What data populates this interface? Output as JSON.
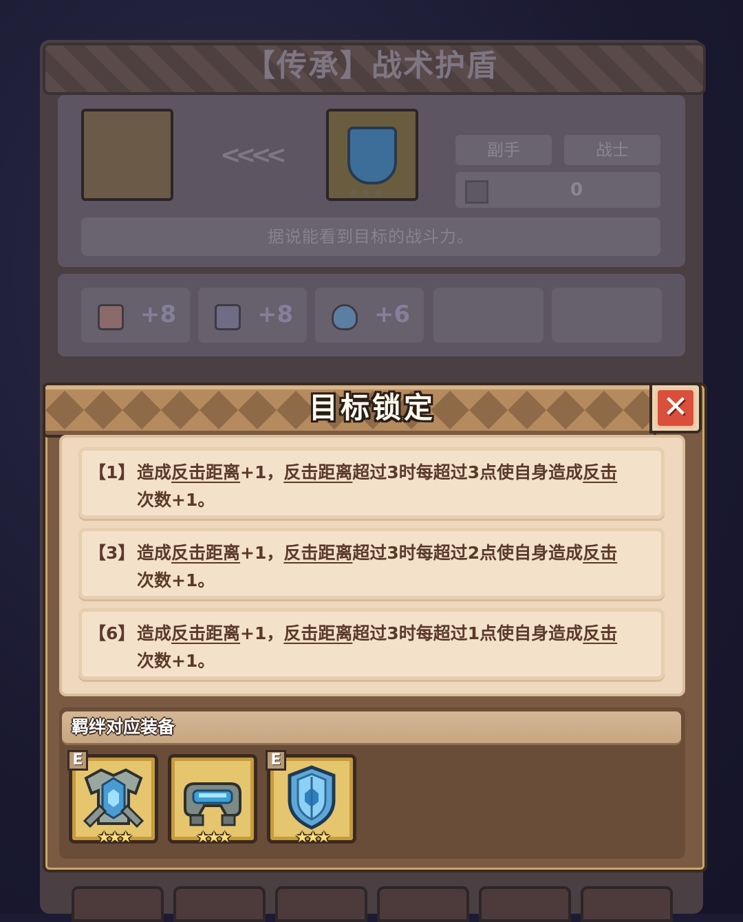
{
  "background": {
    "title": "【传承】战术护盾",
    "arrows": "<<<<",
    "tags": [
      "副手",
      "战士"
    ],
    "power_value": "0",
    "description": "据说能看到目标的战斗力。",
    "stats": [
      {
        "icon": "card-icon",
        "value": "+8"
      },
      {
        "icon": "book-icon",
        "value": "+8"
      },
      {
        "icon": "drop-icon",
        "value": "+6"
      }
    ],
    "item_stars": "★★★"
  },
  "popup": {
    "title": "目标锁定",
    "close_label": "✕",
    "effects": [
      {
        "index": "【1】",
        "pre": "造成",
        "term1": "反击距离",
        "mid1": "+1，",
        "term2": "反击距离",
        "mid2": "超过3时每超过3点使自身造成",
        "term3": "反击",
        "term4": "次数",
        "end": "+1。"
      },
      {
        "index": "【3】",
        "pre": "造成",
        "term1": "反击距离",
        "mid1": "+1，",
        "term2": "反击距离",
        "mid2": "超过3时每超过2点使自身造成",
        "term3": "反击",
        "term4": "次数",
        "end": "+1。"
      },
      {
        "index": "【6】",
        "pre": "造成",
        "term1": "反击距离",
        "mid1": "+1，",
        "term2": "反击距离",
        "mid2": "超过3时每超过1点使自身造成",
        "term3": "反击",
        "term4": "次数",
        "end": "+1。"
      }
    ],
    "bond": {
      "title": "羁绊对应装备",
      "items": [
        {
          "icon": "armor-icon",
          "badge": "E",
          "stars": "★★★"
        },
        {
          "icon": "goggles-icon",
          "badge": "",
          "stars": "★★★"
        },
        {
          "icon": "shield-icon",
          "badge": "E",
          "stars": "★★★"
        }
      ]
    }
  },
  "colors": {
    "popup_body": "#7a5a42",
    "header_band": "#b58a5e",
    "close_red": "#d94f3b",
    "card_bg": "#f3e1c9",
    "text_brown": "#5a3a2a",
    "equip_gold": "#e6c56f"
  }
}
